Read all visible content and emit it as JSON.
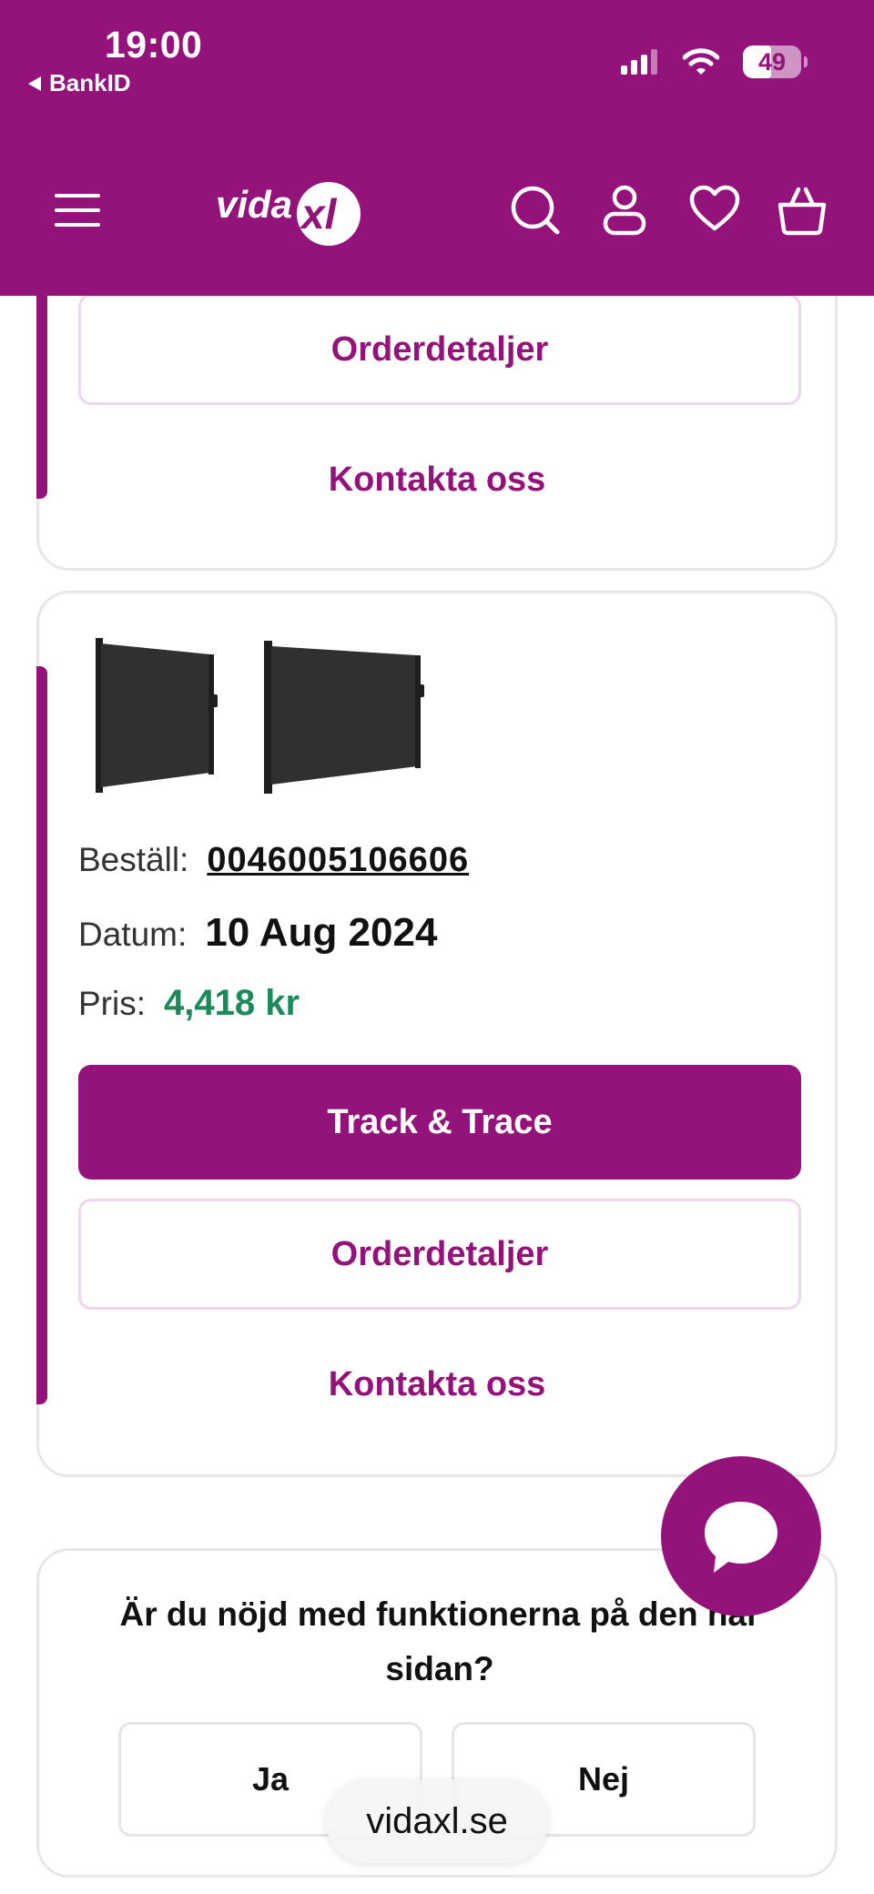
{
  "status_bar": {
    "time": "19:00",
    "back_app": "BankID",
    "battery": "49"
  },
  "header": {
    "logo_text": "vidaXL",
    "menu_icon": "hamburger-menu-icon",
    "search_icon": "search-icon",
    "account_icon": "user-icon",
    "wishlist_icon": "heart-icon",
    "cart_icon": "basket-icon",
    "brand_color": "#93137b"
  },
  "previous_order": {
    "details_label": "Orderdetaljer",
    "contact_label": "Kontakta oss"
  },
  "order": {
    "order_label": "Beställ:",
    "order_number": "0046005106606",
    "date_label": "Datum:",
    "date_value": "10 Aug 2024",
    "price_label": "Pris:",
    "price_value": "4,418 kr",
    "track_label": "Track & Trace",
    "details_label": "Orderdetaljer",
    "contact_label": "Kontakta oss"
  },
  "survey": {
    "question": "Är du nöjd med funktionerna på den här sidan?",
    "yes_label": "Ja",
    "no_label": "Nej"
  },
  "chat": {
    "icon": "chat-bubble-icon"
  },
  "browser": {
    "url": "vidaxl.se"
  }
}
